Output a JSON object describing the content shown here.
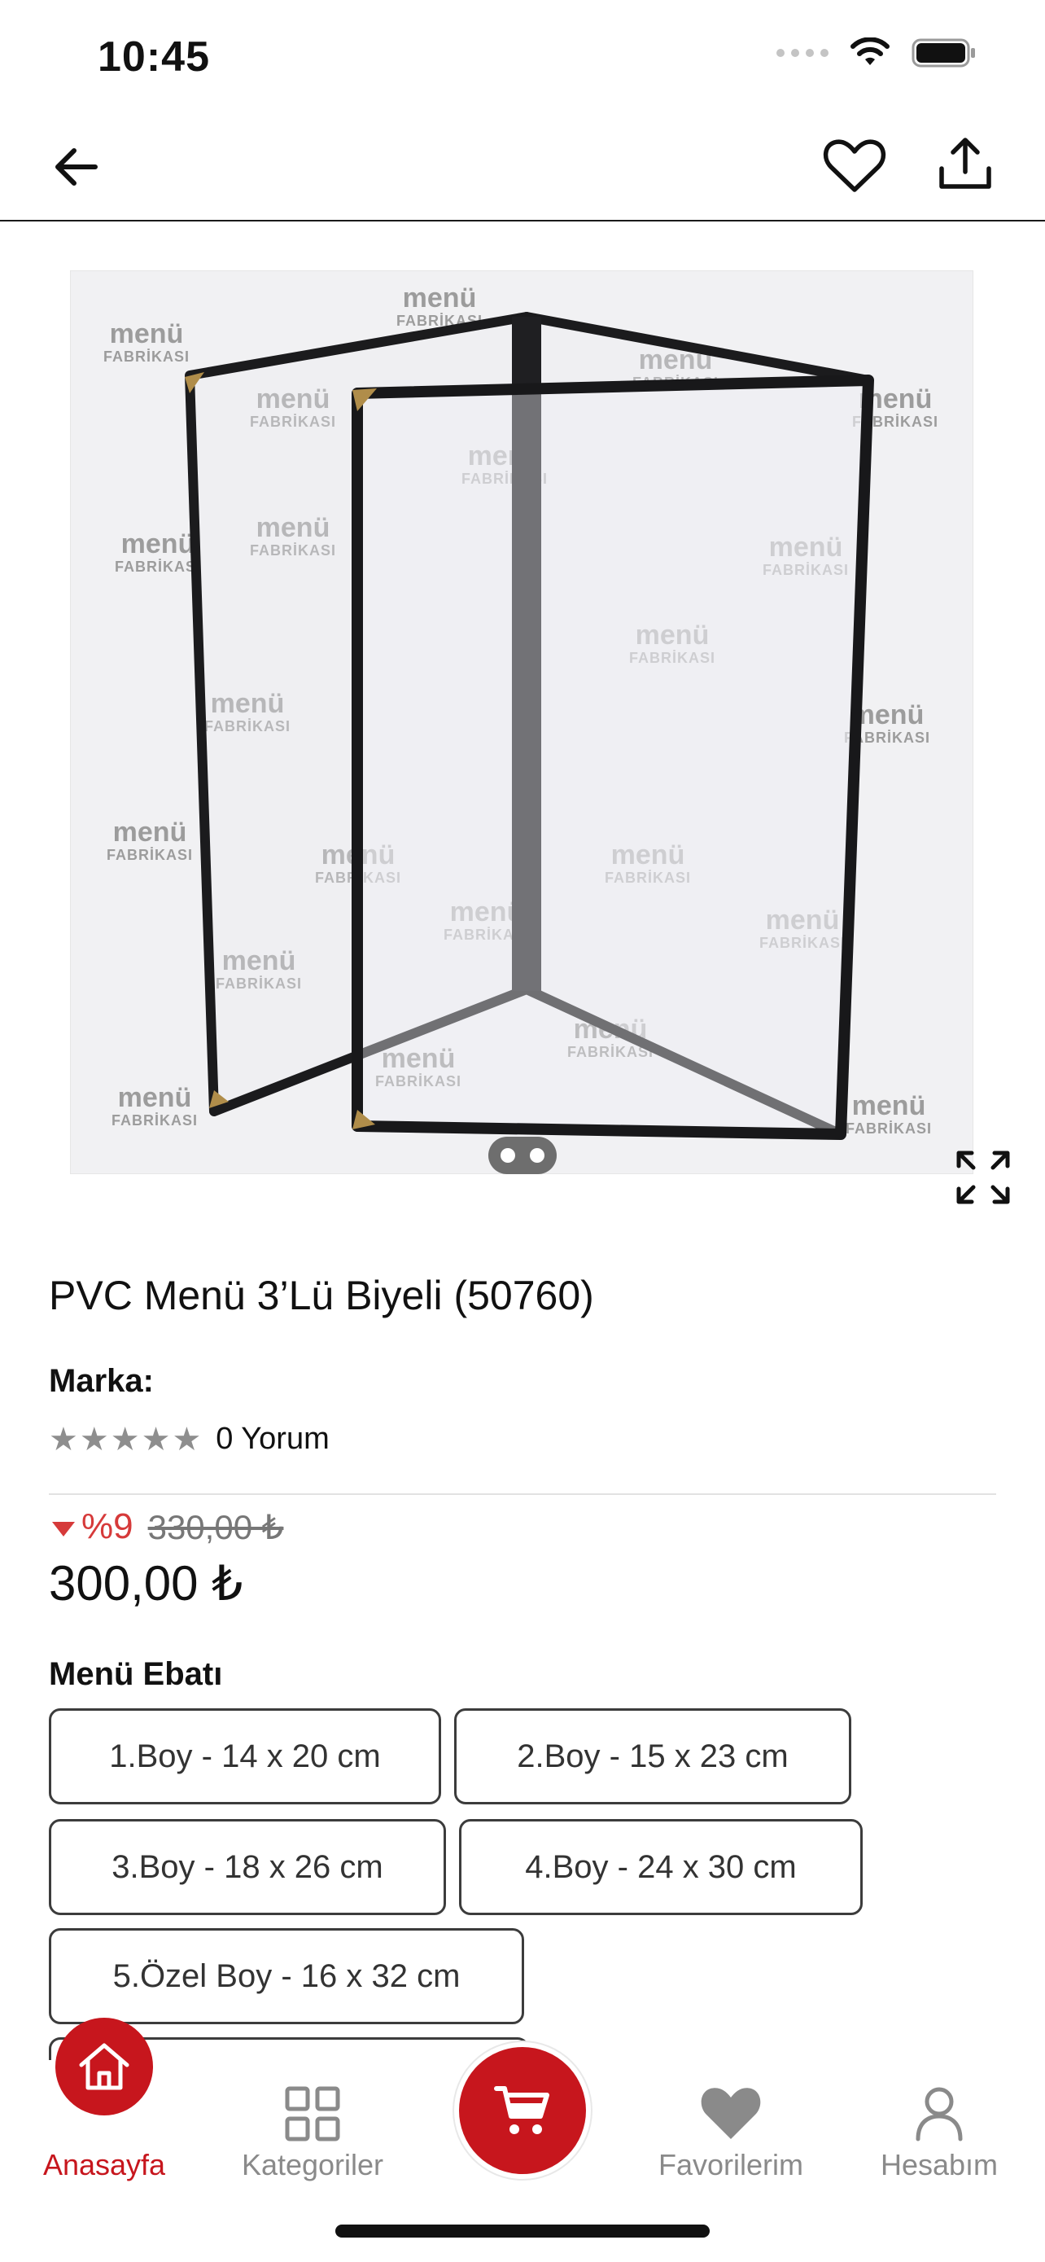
{
  "status_bar": {
    "time": "10:45"
  },
  "header": {
    "back_icon": "arrow-left-icon",
    "favorite_icon": "heart-outline-icon",
    "share_icon": "share-upload-icon"
  },
  "gallery": {
    "watermark_brand": "menü",
    "watermark_sub": "FABRİKASI",
    "expand_icon": "expand-icon"
  },
  "product": {
    "title": "PVC Menü 3’Lü Biyeli (50760)",
    "brand_label": "Marka:",
    "rating_stars": 0,
    "review_text": "0 Yorum",
    "discount": "%9",
    "old_price": "330,00 ₺",
    "price": "300,00 ₺"
  },
  "options": {
    "title": "Menü Ebatı",
    "items": [
      "1.Boy - 14 x 20 cm",
      "2.Boy - 15 x 23 cm",
      "3.Boy - 18 x 26 cm",
      "4.Boy - 24 x 30 cm",
      "5.Özel Boy - 16 x 32 cm"
    ]
  },
  "tab_bar": {
    "items": [
      {
        "label": "Anasayfa",
        "icon": "home-icon",
        "active": true
      },
      {
        "label": "Kategoriler",
        "icon": "grid-icon",
        "active": false
      },
      {
        "label": "",
        "icon": "cart-icon",
        "active": false
      },
      {
        "label": "Favorilerim",
        "icon": "heart-filled-icon",
        "active": false
      },
      {
        "label": "Hesabım",
        "icon": "user-icon",
        "active": false
      }
    ]
  },
  "colors": {
    "accent": "#c7161d",
    "discount": "#d63a3a"
  }
}
